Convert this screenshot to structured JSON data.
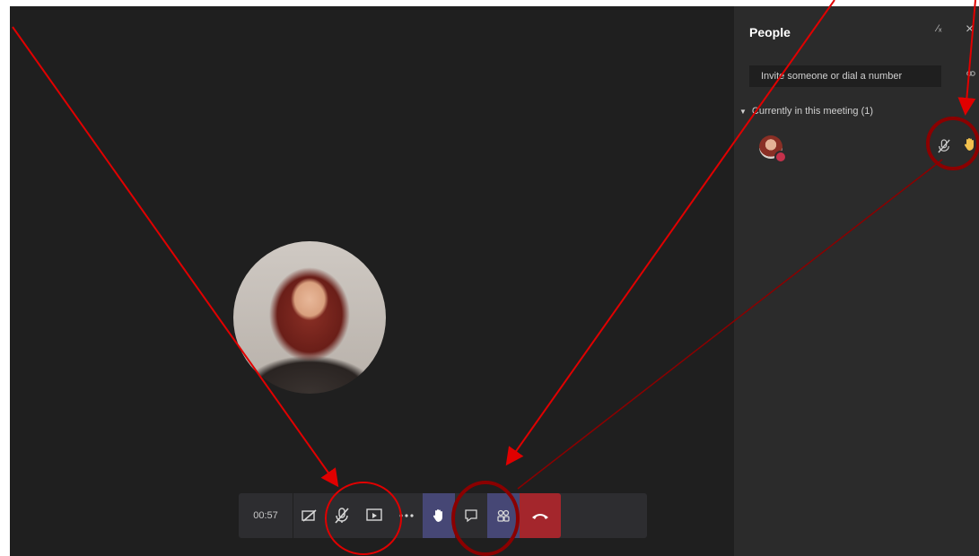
{
  "toolbar": {
    "timer": "00:57",
    "buttons": [
      {
        "name": "camera-off",
        "icon": "camera-off-icon"
      },
      {
        "name": "mic-muted",
        "icon": "mic-off-icon"
      },
      {
        "name": "share-screen",
        "icon": "share-screen-icon"
      },
      {
        "name": "more-actions",
        "icon": "ellipsis-icon"
      },
      {
        "name": "raise-hand",
        "icon": "hand-icon",
        "active": true
      },
      {
        "name": "show-conversation",
        "icon": "chat-icon"
      },
      {
        "name": "show-participants",
        "icon": "people-icon",
        "active": true
      },
      {
        "name": "hang-up",
        "icon": "phone-hangup-icon"
      }
    ]
  },
  "panel": {
    "title": "People",
    "invite_placeholder": "Invite someone or dial a number",
    "section_header": "Currently in this meeting (1)",
    "participant": {
      "mic_state": "muted",
      "hand_raised": true
    }
  },
  "colors": {
    "stage": "#1f1f1f",
    "panel": "#2b2b2b",
    "toolbar": "#2d2d30",
    "active_button": "#464775",
    "hangup": "#a4262c",
    "hand": "#f2c14e",
    "annotation": "#e00000"
  }
}
